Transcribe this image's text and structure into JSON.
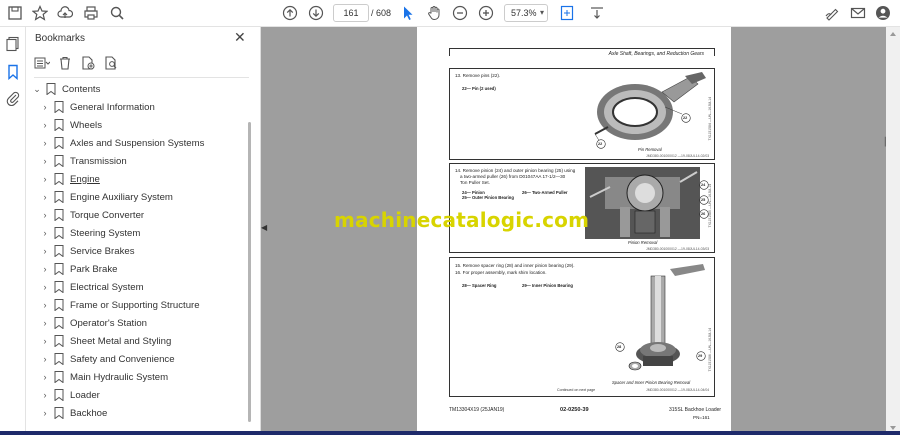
{
  "toolbar": {
    "page_current": "161",
    "page_total": "/ 608",
    "zoom": "57.3%"
  },
  "bookmarks": {
    "title": "Bookmarks",
    "root": "Contents",
    "items": [
      {
        "label": "General Information"
      },
      {
        "label": "Wheels"
      },
      {
        "label": "Axles and Suspension Systems"
      },
      {
        "label": "Transmission"
      },
      {
        "label": "Engine"
      },
      {
        "label": "Engine Auxiliary System"
      },
      {
        "label": "Torque Converter"
      },
      {
        "label": "Steering System"
      },
      {
        "label": "Service Brakes"
      },
      {
        "label": "Park Brake"
      },
      {
        "label": "Electrical System"
      },
      {
        "label": "Frame or Supporting Structure"
      },
      {
        "label": "Operator's Station"
      },
      {
        "label": "Sheet Metal and Styling"
      },
      {
        "label": "Safety and Convenience"
      },
      {
        "label": "Main Hydraulic System"
      },
      {
        "label": "Loader"
      },
      {
        "label": "Backhoe"
      }
    ]
  },
  "document": {
    "header": "Axle Shaft, Bearings, and Reduction Gears",
    "s1": {
      "step": "13. Remove pins (22).",
      "legend": "22— Pin (2 used)",
      "caption": "Pin Removal",
      "code": "JMD380-001000012 —19-08JUL14-02/03",
      "side": "TX1151584 —UN—16JUL14",
      "callouts": [
        "22",
        "22"
      ]
    },
    "s2": {
      "step_a": "14. Remove pinion (24) and outer pinion bearing (25) using",
      "step_b": "a two-armed puller (26) from D01047AA 17-1/2—30",
      "step_c": "Ton Puller Set.",
      "legend_a": "24— Pinion",
      "legend_b": "25— Outer Pinion Bearing",
      "legend_c": "26— Two-Armed Puller",
      "caption": "Pinion Removal",
      "code": "JMD380-001000012 —19-08JUL14-03/03",
      "side": "TX1151585 —UN—16JUL14",
      "callouts": [
        "24",
        "25",
        "26"
      ]
    },
    "s3": {
      "step_a": "15. Remove spacer ring (28) and inner pinion bearing (29).",
      "step_b": "16. For proper assembly, mark shim location.",
      "legend_a": "28— Spacer Ring",
      "legend_b": "29— Inner Pinion Bearing",
      "caption": "Spacer and Inner Pinion Bearing Removal",
      "code": "JMD380-001000012 —19-08JUL14-04/04",
      "side": "TX1151586 —UN—16JUL14",
      "callouts": [
        "28",
        "29"
      ],
      "continued": "Continued on next page"
    },
    "footer_left": "TM13304X19 (25JAN19)",
    "footer_center": "02-0250-39",
    "footer_right": "315SL Backhoe Loader",
    "footer_right2": "PN=161"
  },
  "watermark": "machinecatalogic.com",
  "colors": {
    "accent": "#1a73e8",
    "watermark": "#d8d400",
    "viewer_bg": "#9e9e9e"
  }
}
